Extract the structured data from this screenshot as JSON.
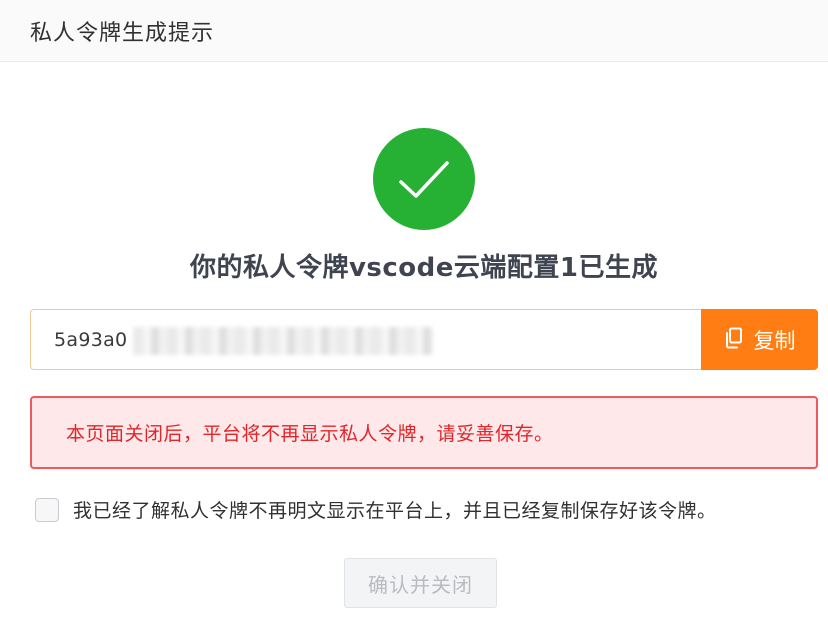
{
  "dialog": {
    "title": "私人令牌生成提示"
  },
  "result": {
    "icon": "checkmark-icon",
    "success_color": "#26b135",
    "headline": "你的私人令牌vscode云端配置1已生成"
  },
  "token": {
    "value_visible_prefix": "5a93a0",
    "is_partially_obscured": true,
    "copy_icon": "copy-icon",
    "copy_label": "复制",
    "copy_button_color": "#ff7d12"
  },
  "warning": {
    "text": "本页面关闭后，平台将不再显示私人令牌，请妥善保存。",
    "color": "#e0262a"
  },
  "confirmation": {
    "checked": false,
    "label": "我已经了解私人令牌不再明文显示在平台上，并且已经复制保存好该令牌。"
  },
  "actions": {
    "confirm_label": "确认并关闭",
    "confirm_disabled": true
  }
}
